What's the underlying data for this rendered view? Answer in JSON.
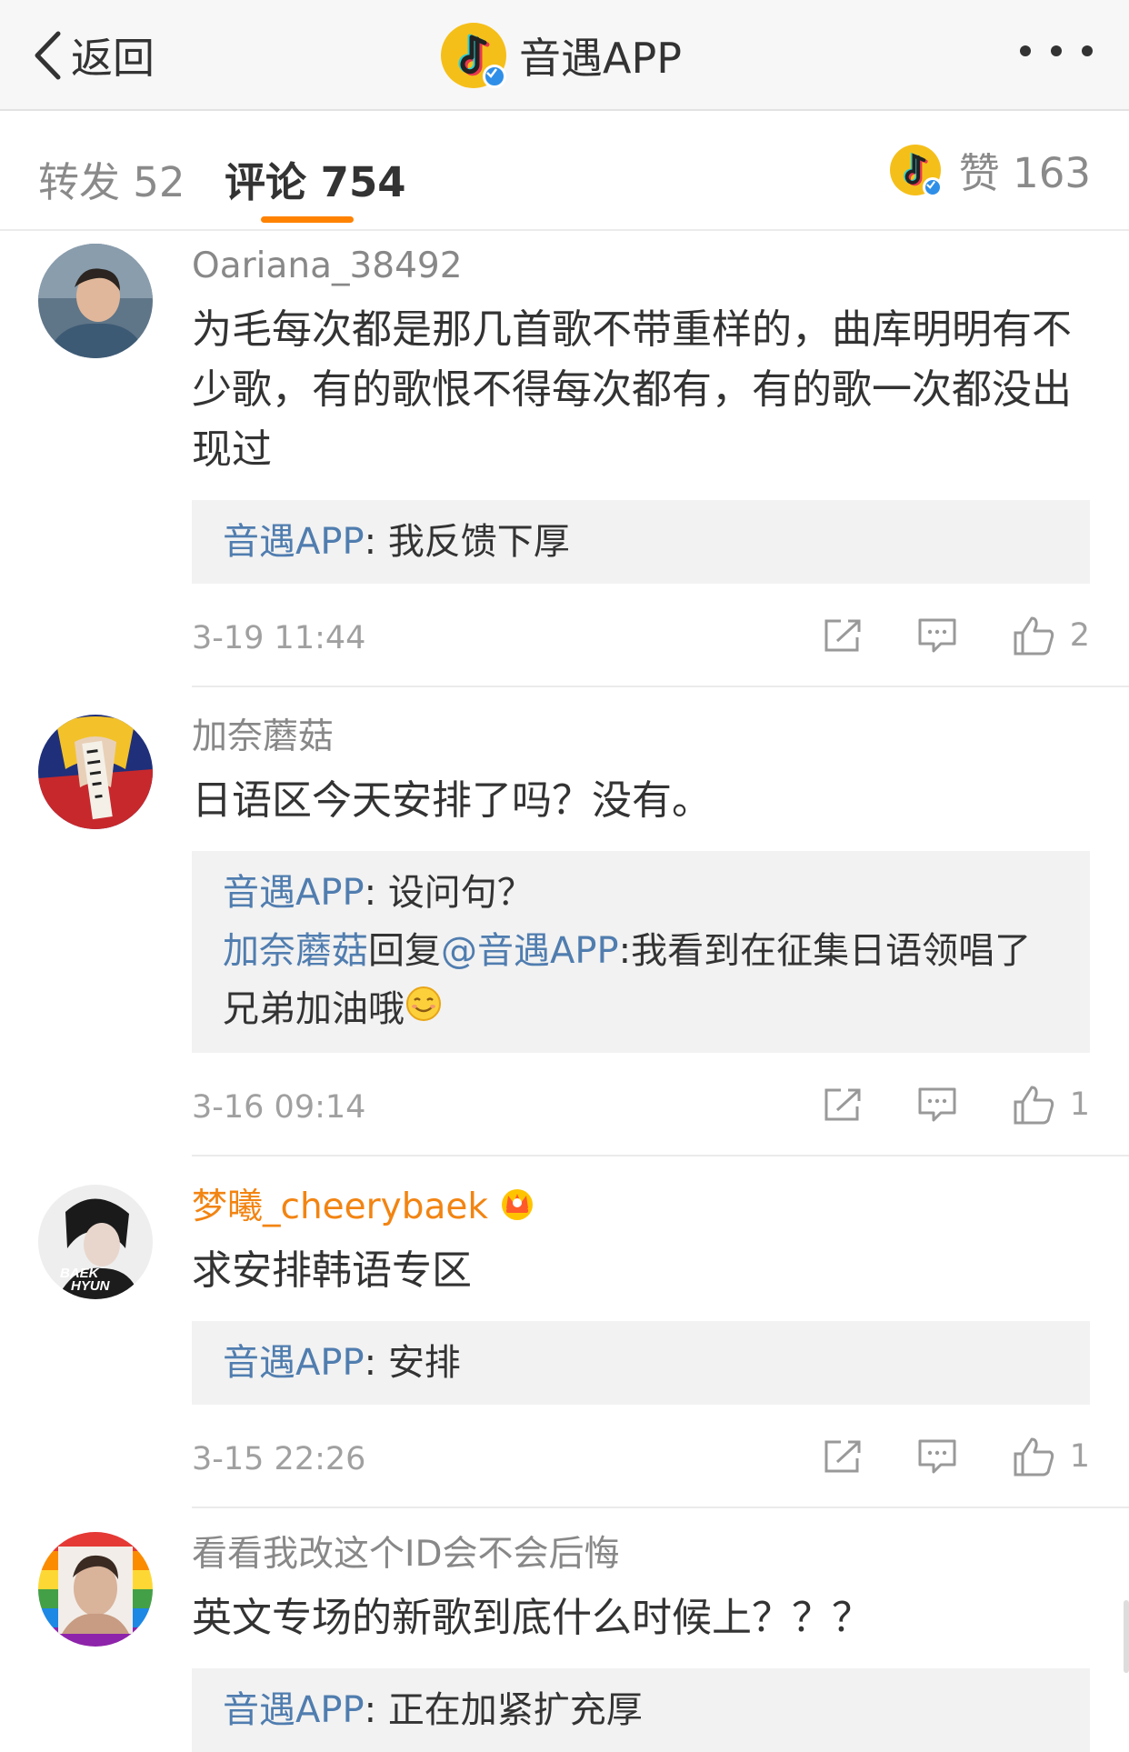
{
  "navbar": {
    "back_label": "返回",
    "title": "音遇APP"
  },
  "tabs": {
    "repost": "转发 52",
    "comment": "评论 754",
    "like": "赞 163"
  },
  "colors": {
    "accent_orange": "#ff8200",
    "link_blue": "#507daf",
    "vip_orange": "#f28412",
    "verified_blue": "#2f8fe8"
  },
  "comments": [
    {
      "username": "Oariana_38492",
      "text": "为毛每次都是那几首歌不带重样的，曲库明明有不少歌，有的歌恨不得每次都有，有的歌一次都没出现过",
      "replies": [
        {
          "author": "音遇APP",
          "sep": ": ",
          "text": "我反馈下厚"
        }
      ],
      "time": "3-19 11:44",
      "likes": "2"
    },
    {
      "username": "加奈蘑菇",
      "text": "日语区今天安排了吗？没有。",
      "replies": [
        {
          "author": "音遇APP",
          "sep": ": ",
          "text": "设问句？"
        },
        {
          "author": "加奈蘑菇",
          "mid": "回复",
          "mention": "@音遇APP",
          "sep": ":",
          "text": "我看到在征集日语领唱了 兄弟加油哦"
        }
      ],
      "time": "3-16 09:14",
      "likes": "1"
    },
    {
      "username": "梦曦_cheerybaek",
      "avatar_text": "BAEK HYUN",
      "text": "求安排韩语专区",
      "replies": [
        {
          "author": "音遇APP",
          "sep": ": ",
          "text": "安排"
        }
      ],
      "time": "3-15 22:26",
      "likes": "1"
    },
    {
      "username": "看看我改这个ID会不会后悔",
      "text": "英文专场的新歌到底什么时候上？？？",
      "replies": [
        {
          "author": "音遇APP",
          "sep": ": ",
          "text": "正在加紧扩充厚"
        }
      ]
    }
  ]
}
